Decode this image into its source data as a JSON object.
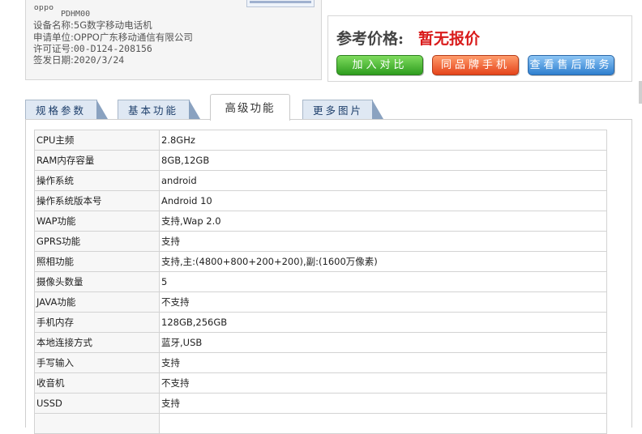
{
  "info": {
    "brand": "oppo",
    "model": "PDHM00",
    "lines": [
      {
        "label": "设备名称",
        "value": "5G数字移动电话机"
      },
      {
        "label": "申请单位",
        "value": "OPPO广东移动通信有限公司"
      },
      {
        "label": "许可证号",
        "value": "00-D124-208156"
      },
      {
        "label": "签发日期",
        "value": "2020/3/24"
      }
    ]
  },
  "price": {
    "label": "参考价格",
    "colon": ":",
    "value": "暂无报价",
    "buttons": [
      "加入对比",
      "同品牌手机",
      "查看售后服务"
    ]
  },
  "tabs": {
    "items": [
      "规格参数",
      "基本功能",
      "高级功能",
      "更多图片"
    ],
    "active": "高级功能"
  },
  "specs": [
    {
      "k": "CPU主频",
      "v": "2.8GHz"
    },
    {
      "k": "RAM内存容量",
      "v": "8GB,12GB"
    },
    {
      "k": "操作系统",
      "v": "android"
    },
    {
      "k": "操作系统版本号",
      "v": "Android 10"
    },
    {
      "k": "WAP功能",
      "v": "支持,Wap 2.0"
    },
    {
      "k": "GPRS功能",
      "v": "支持"
    },
    {
      "k": "照相功能",
      "v": "支持,主:(4800+800+200+200),副:(1600万像素)"
    },
    {
      "k": "摄像头数量",
      "v": "5"
    },
    {
      "k": "JAVA功能",
      "v": "不支持"
    },
    {
      "k": "手机内存",
      "v": "128GB,256GB"
    },
    {
      "k": "本地连接方式",
      "v": "蓝牙,USB"
    },
    {
      "k": "手写输入",
      "v": "支持"
    },
    {
      "k": "收音机",
      "v": "不支持"
    },
    {
      "k": "USSD",
      "v": "支持"
    },
    {
      "k": "",
      "v": ""
    }
  ]
}
